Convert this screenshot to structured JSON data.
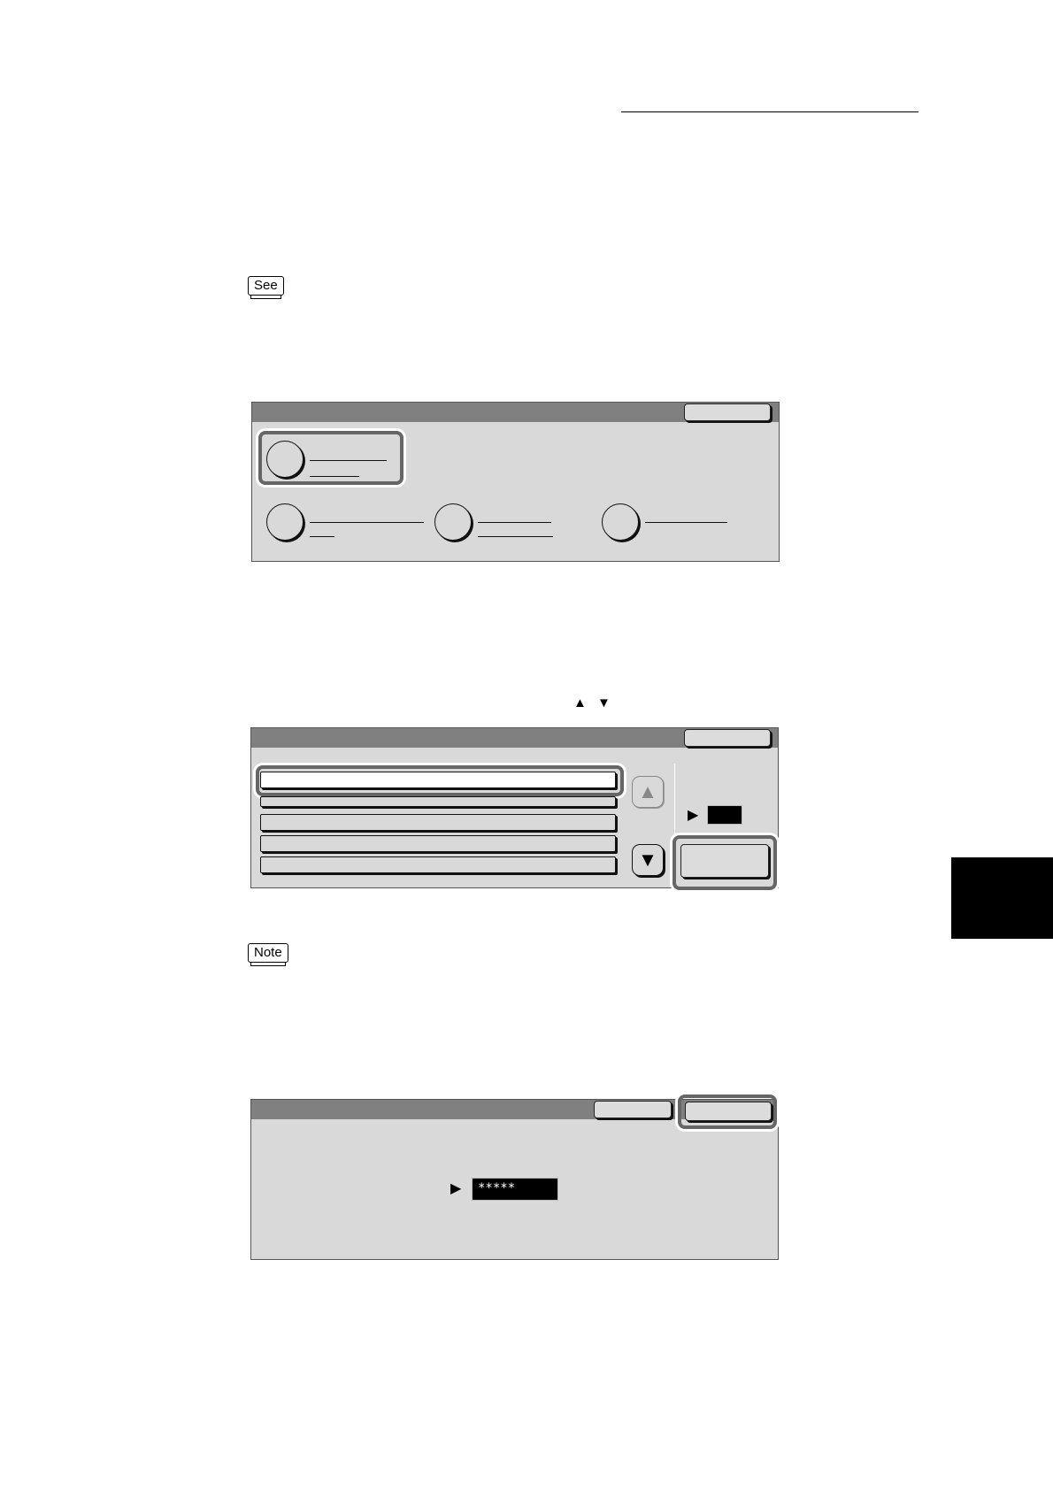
{
  "page": {
    "see_label": "See",
    "note_label": "Note",
    "scroll_arrows": "▲ ▼"
  },
  "screen2": {
    "up_arrow": "▲",
    "down_arrow": "▼",
    "pointer": "▶"
  },
  "screen3": {
    "pointer": "▶",
    "password_value": "*****"
  }
}
